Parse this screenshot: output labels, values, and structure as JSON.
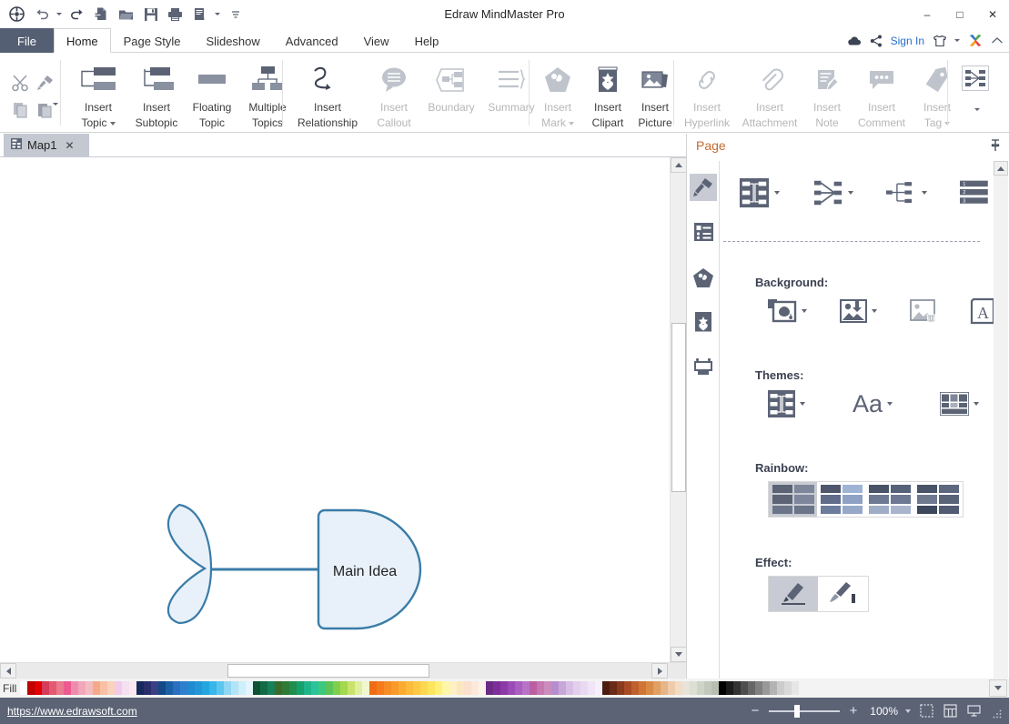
{
  "window": {
    "title": "Edraw MindMaster Pro",
    "minimize": "–",
    "maximize": "□",
    "close": "✕"
  },
  "quick_access": {
    "icons": [
      "app-logo-icon",
      "undo-icon",
      "undo-dropdown-caret",
      "redo-icon",
      "new-document-icon",
      "open-folder-icon",
      "save-icon",
      "print-icon",
      "print-preview-icon",
      "print-dropdown-caret",
      "customize-qat-caret"
    ]
  },
  "menu": {
    "tabs": [
      {
        "label": "File",
        "id": "file",
        "active": false
      },
      {
        "label": "Home",
        "id": "home",
        "active": true
      },
      {
        "label": "Page Style",
        "id": "page-style",
        "active": false
      },
      {
        "label": "Slideshow",
        "id": "slideshow",
        "active": false
      },
      {
        "label": "Advanced",
        "id": "advanced",
        "active": false
      },
      {
        "label": "View",
        "id": "view",
        "active": false
      },
      {
        "label": "Help",
        "id": "help",
        "active": false
      }
    ],
    "right": {
      "cloud_icon": "cloud-icon",
      "share_icon": "share-icon",
      "sign_in": "Sign In",
      "theme_icon": "shirt-icon",
      "edraw_icon": "edraw-x-icon",
      "collapse_icon": "collapse-ribbon-icon"
    }
  },
  "ribbon": {
    "clipboard": {
      "cut": "cut-icon",
      "format_painter": "format-painter-icon",
      "copy": "copy-icon",
      "paste": "paste-icon"
    },
    "groups": [
      {
        "name": "topics",
        "buttons": [
          {
            "id": "insert-topic",
            "line1": "Insert",
            "line2": "Topic",
            "caret": true,
            "disabled": false
          },
          {
            "id": "insert-subtopic",
            "line1": "Insert",
            "line2": "Subtopic",
            "caret": false,
            "disabled": false
          },
          {
            "id": "floating-topic",
            "line1": "Floating",
            "line2": "Topic",
            "caret": false,
            "disabled": false
          },
          {
            "id": "multiple-topics",
            "line1": "Multiple",
            "line2": "Topics",
            "caret": false,
            "disabled": false
          }
        ]
      },
      {
        "name": "relationship",
        "buttons": [
          {
            "id": "insert-relationship",
            "line1": "Insert",
            "line2": "Relationship",
            "caret": false,
            "disabled": false
          },
          {
            "id": "insert-callout",
            "line1": "Insert",
            "line2": "Callout",
            "caret": false,
            "disabled": true
          },
          {
            "id": "boundary",
            "line1": "Boundary",
            "line2": "",
            "caret": false,
            "disabled": true
          },
          {
            "id": "summary",
            "line1": "Summary",
            "line2": "",
            "caret": false,
            "disabled": true
          }
        ]
      },
      {
        "name": "media",
        "buttons": [
          {
            "id": "insert-mark",
            "line1": "Insert",
            "line2": "Mark",
            "caret": true,
            "disabled": true
          },
          {
            "id": "insert-clipart",
            "line1": "Insert",
            "line2": "Clipart",
            "caret": false,
            "disabled": false
          },
          {
            "id": "insert-picture",
            "line1": "Insert",
            "line2": "Picture",
            "caret": false,
            "disabled": false
          }
        ]
      },
      {
        "name": "annotations",
        "buttons": [
          {
            "id": "insert-hyperlink",
            "line1": "Insert",
            "line2": "Hyperlink",
            "caret": false,
            "disabled": true
          },
          {
            "id": "insert-attachment",
            "line1": "Insert",
            "line2": "Attachment",
            "caret": false,
            "disabled": true
          },
          {
            "id": "insert-note",
            "line1": "Insert",
            "line2": "Note",
            "caret": false,
            "disabled": true
          },
          {
            "id": "insert-comment",
            "line1": "Insert",
            "line2": "Comment",
            "caret": false,
            "disabled": true
          },
          {
            "id": "insert-tag",
            "line1": "Insert",
            "line2": "Tag",
            "caret": true,
            "disabled": true
          }
        ]
      }
    ],
    "layout_button": "layout-icon",
    "more_caret": "ribbon-more-caret"
  },
  "document_tabs": [
    {
      "label": "Map1",
      "icon": "map-doc-icon",
      "close": "✕",
      "active": true
    }
  ],
  "canvas": {
    "shape_label": "Main Idea",
    "shape_type": "fishbone-head",
    "fill_color": "#e8f1f9",
    "stroke_color": "#3a7ca8",
    "text_color": "#1f1f1f"
  },
  "right_panel": {
    "title": "Page",
    "pin_icon": "pin-icon",
    "rail": [
      {
        "id": "style-brush",
        "icon": "paint-brush-icon",
        "selected": true
      },
      {
        "id": "outline",
        "icon": "outline-list-icon",
        "selected": false
      },
      {
        "id": "mark",
        "icon": "mark-pentagon-icon",
        "selected": false
      },
      {
        "id": "clipart",
        "icon": "clipart-star-icon",
        "selected": false
      },
      {
        "id": "slide",
        "icon": "slide-board-icon",
        "selected": false
      }
    ],
    "layout_tools": [
      {
        "id": "layout-structure",
        "icon": "mindmap-layout-icon",
        "caret": true
      },
      {
        "id": "layout-radial",
        "icon": "radial-layout-icon",
        "caret": true
      },
      {
        "id": "layout-branch",
        "icon": "branch-layout-icon",
        "caret": true
      },
      {
        "id": "layout-numbering",
        "icon": "numbering-icon",
        "caret": true
      }
    ],
    "sections": [
      {
        "title": "Background:",
        "tools": [
          {
            "id": "background-color",
            "icon": "background-fill-icon",
            "caret": true,
            "disabled": false
          },
          {
            "id": "background-image",
            "icon": "background-image-icon",
            "caret": true,
            "disabled": false
          },
          {
            "id": "remove-background",
            "icon": "remove-background-icon",
            "caret": false,
            "disabled": true
          },
          {
            "id": "watermark",
            "icon": "watermark-a-icon",
            "caret": true,
            "disabled": false
          }
        ]
      },
      {
        "title": "Themes:",
        "tools": [
          {
            "id": "theme-style",
            "icon": "theme-shape-icon",
            "caret": true,
            "disabled": false
          },
          {
            "id": "theme-font",
            "icon": "theme-font-icon",
            "label": "Aa",
            "caret": true,
            "disabled": false
          },
          {
            "id": "theme-color",
            "icon": "theme-color-icon",
            "caret": true,
            "disabled": false
          }
        ]
      }
    ],
    "rainbow": {
      "title": "Rainbow:",
      "options": [
        {
          "id": "rainbow-1",
          "selected": true,
          "colors": [
            "#5b6375",
            "#7d869b",
            "#5b6375",
            "#7d869b",
            "#6b7488",
            "#6b7488"
          ]
        },
        {
          "id": "rainbow-2",
          "selected": false,
          "colors": [
            "#4e576b",
            "#9fb4d4",
            "#5f6d8a",
            "#8fa2c4",
            "#6b7c9c",
            "#97a9c8"
          ]
        },
        {
          "id": "rainbow-3",
          "selected": false,
          "colors": [
            "#4a5468",
            "#56617a",
            "#6d7992",
            "#6d7992",
            "#9fadc6",
            "#a8b5cc"
          ]
        },
        {
          "id": "rainbow-4",
          "selected": false,
          "colors": [
            "#4a5468",
            "#5d6880",
            "#6e7990",
            "#5a6479",
            "#3d475c",
            "#515c72"
          ]
        }
      ]
    },
    "effect": {
      "title": "Effect:",
      "options": [
        {
          "id": "effect-pen",
          "icon": "pen-effect-icon",
          "selected": true
        },
        {
          "id": "effect-brush",
          "icon": "brush-effect-icon",
          "selected": false
        }
      ]
    }
  },
  "palette": {
    "label": "Fill",
    "colors": [
      "#ffffff",
      "#c00000",
      "#e00000",
      "#d63b5a",
      "#e35b6e",
      "#ea7a90",
      "#ec5b8e",
      "#f08bb0",
      "#f1a7b9",
      "#f3bcc2",
      "#f6a98a",
      "#f8c1a3",
      "#fad2bd",
      "#f0ccea",
      "#f5dff0",
      "#fbe9ee",
      "#17295c",
      "#2a2f6b",
      "#3a3f86",
      "#124a87",
      "#1b5fa5",
      "#2b6fc0",
      "#2f7fd0",
      "#1f8bd0",
      "#2396d8",
      "#23a6e0",
      "#38b6e8",
      "#5cc6ef",
      "#8fd7f3",
      "#b3e3f7",
      "#cdeefb",
      "#e4f5fd",
      "#0e5233",
      "#116b47",
      "#17805a",
      "#3b6b2a",
      "#2f7a34",
      "#1e8d4e",
      "#17a06a",
      "#1fb489",
      "#2bc39a",
      "#3cc97e",
      "#5ac45a",
      "#7fcf4d",
      "#a4d84f",
      "#c8e36a",
      "#e0eea0",
      "#f0f7cf",
      "#f06c13",
      "#f57a1c",
      "#f78c24",
      "#f99a2b",
      "#fbab32",
      "#fcbb3a",
      "#fdc944",
      "#fed750",
      "#ffe45e",
      "#fff07a",
      "#fff6a8",
      "#fdf0c3",
      "#fce6c2",
      "#fbe0cd",
      "#fde8dc",
      "#fdf2ea",
      "#6b2a86",
      "#7c2f9a",
      "#8c3aa8",
      "#9a4bb5",
      "#a95ec0",
      "#b873c9",
      "#bb5fa0",
      "#c577b0",
      "#cd8cbf",
      "#b78ecd",
      "#c7a6da",
      "#d7bee5",
      "#e2cfee",
      "#ead9f2",
      "#f0e4f6",
      "#f7f0fa",
      "#4a1d10",
      "#6b2a16",
      "#8a3a1d",
      "#a64b24",
      "#bf5f2c",
      "#cf7535",
      "#d98a45",
      "#e0a062",
      "#e7b586",
      "#eecbab",
      "#f2dcc7",
      "#e8e4d8",
      "#dcdfd3",
      "#cfd4c6",
      "#c3c9bc",
      "#b8bfb1",
      "#000000",
      "#1a1a1a",
      "#333333",
      "#4d4d4d",
      "#666666",
      "#808080",
      "#999999",
      "#b3b3b3",
      "#cccccc",
      "#d9d9d9",
      "#e6e6e6",
      "#f2f2f2"
    ]
  },
  "status_bar": {
    "url": "https://www.edrawsoft.com",
    "zoom_out": "−",
    "zoom_in": "+",
    "zoom_value": "100%",
    "view_buttons": [
      "fit-page-icon",
      "grid-view-icon",
      "presentation-icon"
    ]
  }
}
